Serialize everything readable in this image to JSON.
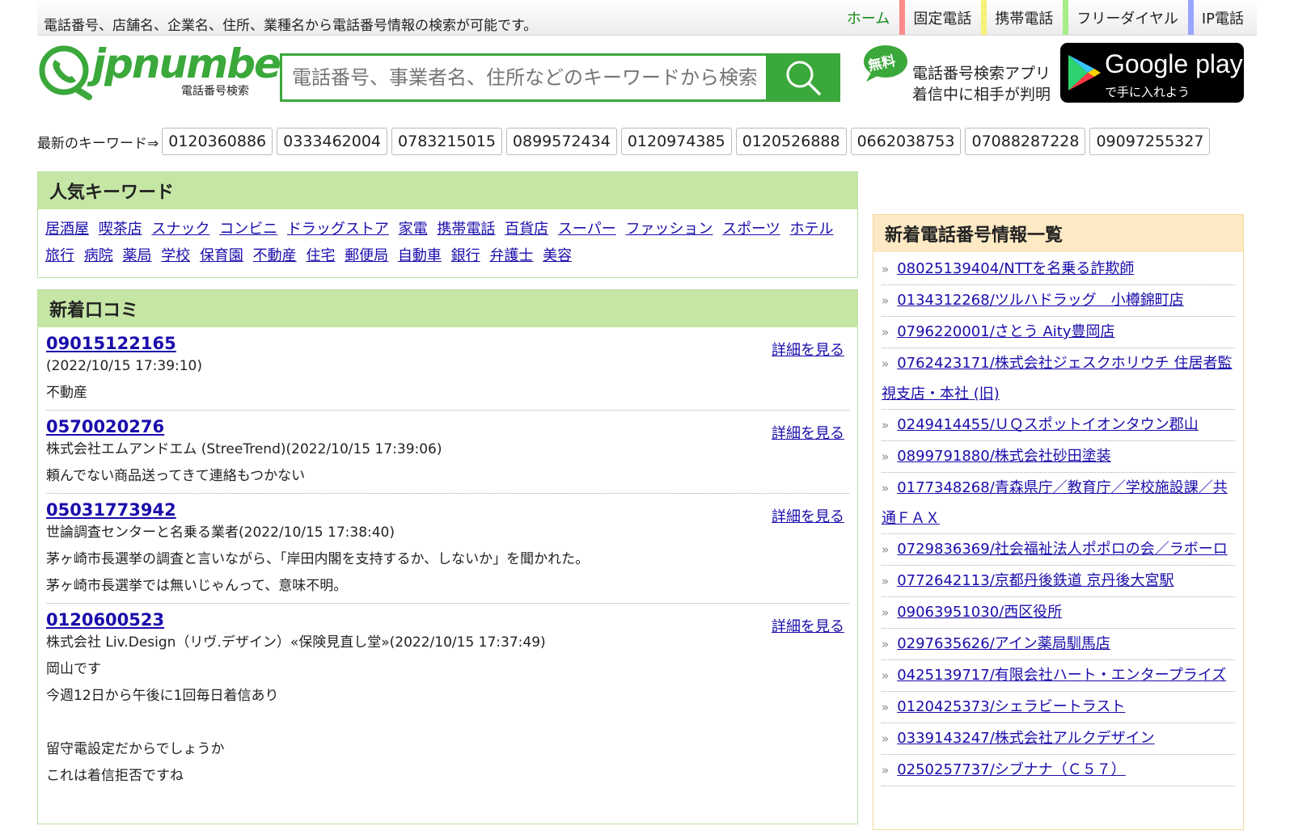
{
  "header": {
    "tagline": "電話番号、店舗名、企業名、住所、業種名から電話番号情報の検索が可能です。",
    "nav": [
      "ホーム",
      "固定電話",
      "携帯電話",
      "フリーダイヤル",
      "IP電話"
    ]
  },
  "logo": {
    "name": "jpnumber",
    "subtitle": "電話番号検索"
  },
  "search": {
    "placeholder": "電話番号、事業者名、住所などのキーワードから検索"
  },
  "app": {
    "badge": "無料",
    "line1": "電話番号検索アプリ",
    "line2": "着信中に相手が判明",
    "store_title": "Google play",
    "store_sub": "で手に入れよう"
  },
  "recent_keywords": {
    "label": "最新のキーワード⇒",
    "items": [
      "0120360886",
      "0333462004",
      "0783215015",
      "0899572434",
      "0120974385",
      "0120526888",
      "0662038753",
      "07088287228",
      "09097255327"
    ]
  },
  "popular": {
    "title": "人気キーワード",
    "items": [
      "居酒屋",
      "喫茶店",
      "スナック",
      "コンビニ",
      "ドラッグストア",
      "家電",
      "携帯電話",
      "百貨店",
      "スーパー",
      "ファッション",
      "スポーツ",
      "ホテル",
      "旅行",
      "病院",
      "薬局",
      "学校",
      "保育園",
      "不動産",
      "住宅",
      "郵便局",
      "自動車",
      "銀行",
      "弁護士",
      "美容"
    ]
  },
  "reviews": {
    "title": "新着口コミ",
    "detail_label": "詳細を見る",
    "items": [
      {
        "number": "09015122165",
        "meta": "(2022/10/15 17:39:10)",
        "lines": [
          "不動産"
        ]
      },
      {
        "number": "0570020276",
        "meta": "株式会社エムアンドエム (StreeTrend)(2022/10/15 17:39:06)",
        "lines": [
          "頼んでない商品送ってきて連絡もつかない"
        ]
      },
      {
        "number": "05031773942",
        "meta": "世論調査センターと名乗る業者(2022/10/15 17:38:40)",
        "lines": [
          "茅ヶ崎市長選挙の調査と言いながら、「岸田内閣を支持するか、しないか」を聞かれた。",
          "茅ヶ崎市長選挙では無いじゃんって、意味不明。"
        ]
      },
      {
        "number": "0120600523",
        "meta": "株式会社 Liv.Design（リヴ.デザイン）«保険見直し堂»(2022/10/15 17:37:49)",
        "lines": [
          "岡山です",
          "今週12日から午後に1回毎日着信あり",
          "",
          "留守電設定だからでしょうか",
          "これは着信拒否ですね"
        ]
      }
    ]
  },
  "new_numbers": {
    "title": "新着電話番号情報一覧",
    "items": [
      "08025139404/NTTを名乗る詐欺師",
      "0134312268/ツルハドラッグ　小樽錦町店",
      "0796220001/さとう Aity豊岡店",
      "0762423171/株式会社ジェスクホリウチ 住居者監視支店・本社 (旧)",
      "0249414455/ＵＱスポットイオンタウン郡山",
      "0899791880/株式会社砂田塗装",
      "0177348268/青森県庁／教育庁／学校施設課／共通ＦＡＸ",
      "0729836369/社会福祉法人ポポロの会／ラボーロ",
      "0772642113/京都丹後鉄道 京丹後大宮駅",
      "09063951030/西区役所",
      "0297635626/アイン薬局馴馬店",
      "0425139717/有限会社ハート・エンタープライズ",
      "0120425373/シェラビートラスト",
      "0339143247/株式会社アルクデザイン",
      "0250257737/シブナナ（Ｃ５７）"
    ]
  }
}
